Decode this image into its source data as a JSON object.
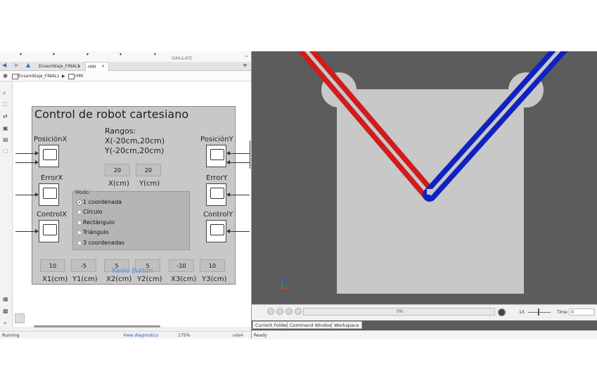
{
  "editor": {
    "toolbar_section": "SIMULATE",
    "tabs": [
      {
        "label": "Ensamblaje_FINAL1",
        "close": "×"
      },
      {
        "label": "HMI",
        "close": "×"
      }
    ],
    "breadcrumb": {
      "root": "Ensamblaje_FINAL1",
      "separator": "▶",
      "current": "HMI"
    },
    "status": {
      "state": "Running",
      "diagnostics": "View diagnostics",
      "zoom": "175%",
      "solver": "ode4"
    }
  },
  "hmi": {
    "title": "Control de robot cartesiano",
    "ranges": {
      "heading": "Rangos:",
      "x_range": "X(-20cm,20cm)",
      "y_range": "Y(-20cm,20cm)"
    },
    "scopes_left": [
      "PosiciónX",
      "ErrorX",
      "ControlX"
    ],
    "scopes_right": [
      "PosiciónY",
      "ErrorY",
      "ControlY"
    ],
    "xy_inputs": [
      {
        "value": "20",
        "label": "X(cm)"
      },
      {
        "value": "20",
        "label": "Y(cm)"
      }
    ],
    "mode": {
      "label": "Modo:",
      "selected": "1 coordenada",
      "options": [
        "1 coordenada",
        "Círculo",
        "Rectángulo",
        "Triángulo",
        "3 coordenadas"
      ]
    },
    "radio_button_caption": "Radio Button",
    "coord_inputs": [
      {
        "value": "10",
        "label": "X1(cm)"
      },
      {
        "value": "-5",
        "label": "Y1(cm)"
      },
      {
        "value": "5",
        "label": "X2(cm)"
      },
      {
        "value": "5",
        "label": "Y2(cm)"
      },
      {
        "value": "-10",
        "label": "X3(cm)"
      },
      {
        "value": "10",
        "label": "Y3(cm)"
      }
    ]
  },
  "mechanics": {
    "progress_text": "0%",
    "progress_fraction": 0.0,
    "speed": "1X",
    "time_label": "Time",
    "time_value": "0",
    "colors": {
      "background": "#5c5c5c",
      "plate": "#c8c8c8",
      "left_arm": "#d01c1c",
      "right_arm": "#1022c0"
    }
  },
  "workspace_tabs": [
    "Current Folder",
    "Command Window",
    "Workspace"
  ],
  "matlab_status": "Ready",
  "icons": [
    "back-arrow-icon",
    "forward-arrow-icon",
    "up-arrow-icon",
    "zoom-icon",
    "fit-view-icon",
    "arrow-icon",
    "image-icon",
    "library-icon",
    "checkbox-icon",
    "play-icon",
    "step-back-icon",
    "step-forward-icon",
    "record-icon",
    "expand-icon"
  ]
}
